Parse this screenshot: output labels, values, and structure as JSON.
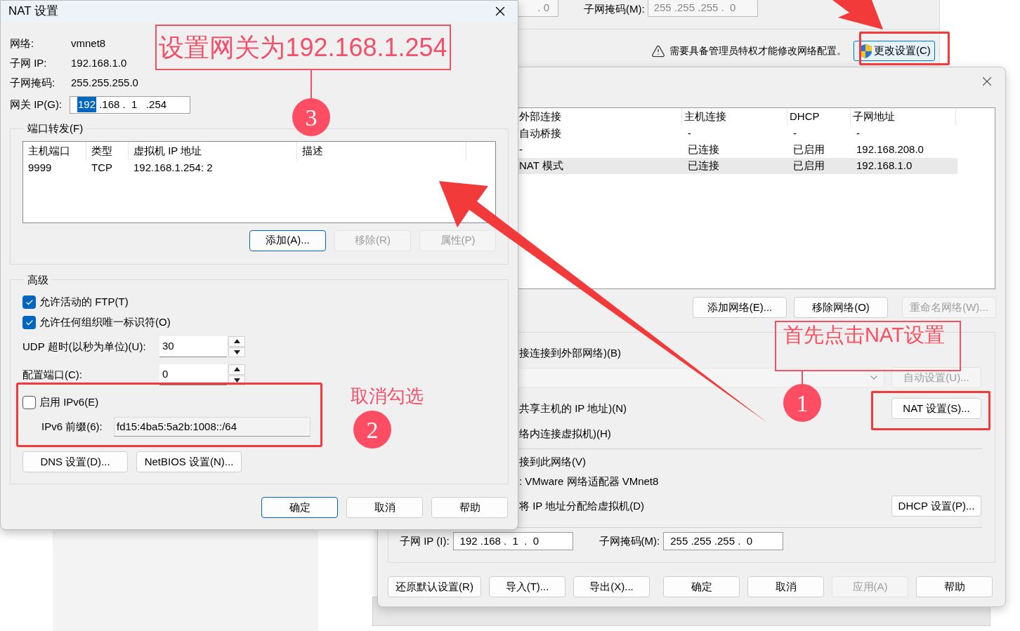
{
  "background_window": {
    "partial_field": ". 0",
    "subnet_mask_label": "子网掩码(M):",
    "subnet_mask_value": "255 .255 .255 .  0",
    "warning": "需要具备管理员特权才能修改网络配置。",
    "change_button": {
      "label": "更改设置(C)",
      "disabled": false
    }
  },
  "network_editor": {
    "table": {
      "columns": [
        "外部连接",
        "主机连接",
        "DHCP",
        "子网地址"
      ],
      "rows": [
        {
          "cells": [
            "自动桥接",
            "-",
            "-",
            "-"
          ],
          "selected": false
        },
        {
          "cells": [
            "-",
            "已连接",
            "已启用",
            "192.168.208.0"
          ],
          "selected": false
        },
        {
          "cells": [
            "NAT 模式",
            "已连接",
            "已启用",
            "192.168.1.0"
          ],
          "selected": true
        }
      ]
    },
    "table_buttons": [
      {
        "label": "添加网络(E)...",
        "disabled": false
      },
      {
        "label": "移除网络(O)",
        "disabled": false
      },
      {
        "label": "重命名网络(W)...",
        "disabled": true
      }
    ],
    "bridged_option": "接连接到外部网络)(B)",
    "auto_button": {
      "label": "自动设置(U)...",
      "disabled": true
    },
    "nat_option": "共享主机的 IP 地址)(N)",
    "nat_button": {
      "label": "NAT 设置(S)...",
      "disabled": false
    },
    "host_only_option": "络内连接虚拟机)(H)",
    "connect_adapter_option": "接到此网络(V)",
    "adapter_name": ": VMware 网络适配器 VMnet8",
    "dhcp_option": "将 IP 地址分配给虚拟机(D)",
    "dhcp_button": {
      "label": "DHCP 设置(P)...",
      "disabled": false
    },
    "subnet_ip": {
      "label": "子网 IP (I):",
      "value": "192 .168 .  1  .  0"
    },
    "subnet_mask": {
      "label": "子网掩码(M):",
      "value": "255 .255 .255 .  0"
    },
    "footer_buttons": [
      {
        "label": "还原默认设置(R)",
        "disabled": false
      },
      {
        "label": "导入(T)...",
        "disabled": false
      },
      {
        "label": "导出(X)...",
        "disabled": false
      },
      {
        "label": "确定",
        "disabled": false
      },
      {
        "label": "取消",
        "disabled": false
      },
      {
        "label": "应用(A)",
        "disabled": true
      },
      {
        "label": "帮助",
        "disabled": false
      }
    ]
  },
  "nat_dialog": {
    "title": "NAT 设置",
    "info": [
      {
        "label": "网络:",
        "value": "vmnet8"
      },
      {
        "label": "子网 IP:",
        "value": "192.168.1.0"
      },
      {
        "label": "子网掩码:",
        "value": "255.255.255.0"
      }
    ],
    "gateway": {
      "label": "网关 IP(G):",
      "parts": [
        {
          "text": "192",
          "selected": true
        },
        {
          "text": " .168 .  1   .254",
          "selected": false
        }
      ]
    },
    "port_forwarding": {
      "legend": "端口转发(F)",
      "columns": [
        "主机端口",
        "类型",
        "虚拟机 IP 地址",
        "描述"
      ],
      "rows": [
        [
          "9999",
          "TCP",
          "192.168.1.254: 2",
          ""
        ]
      ],
      "buttons": [
        {
          "label": "添加(A)...",
          "disabled": false,
          "default": true
        },
        {
          "label": "移除(R)",
          "disabled": true,
          "default": false
        },
        {
          "label": "属性(P)",
          "disabled": true,
          "default": false
        }
      ]
    },
    "advanced": {
      "legend": "高级",
      "checkboxes": [
        {
          "label": "允许活动的 FTP(T)",
          "checked": true
        },
        {
          "label": "允许任何组织唯一标识符(O)",
          "checked": true
        }
      ],
      "spinners": [
        {
          "label": "UDP 超时(以秒为单位)(U):",
          "value": "30"
        },
        {
          "label": "配置端口(C):",
          "value": "0"
        }
      ],
      "ipv6": {
        "label": "启用 IPv6(E)",
        "checked": false,
        "prefix_label": "IPv6 前缀(6):",
        "prefix_value": "fd15:4ba5:5a2b:1008::/64"
      },
      "buttons": [
        {
          "label": "DNS 设置(D)...",
          "disabled": false,
          "default": false
        },
        {
          "label": "NetBIOS 设置(N)...",
          "disabled": false,
          "default": false
        }
      ]
    },
    "footer_buttons": [
      {
        "label": "确定",
        "disabled": false,
        "default": true
      },
      {
        "label": "取消",
        "disabled": false,
        "default": false
      },
      {
        "label": "帮助",
        "disabled": false,
        "default": false
      }
    ]
  },
  "annotations": {
    "callouts": [
      {
        "number": "3",
        "text": "设置网关为192.168.1.254"
      },
      {
        "number": "2",
        "text": "取消勾选"
      },
      {
        "number": "1",
        "text": "首先点击NAT设置"
      }
    ]
  }
}
